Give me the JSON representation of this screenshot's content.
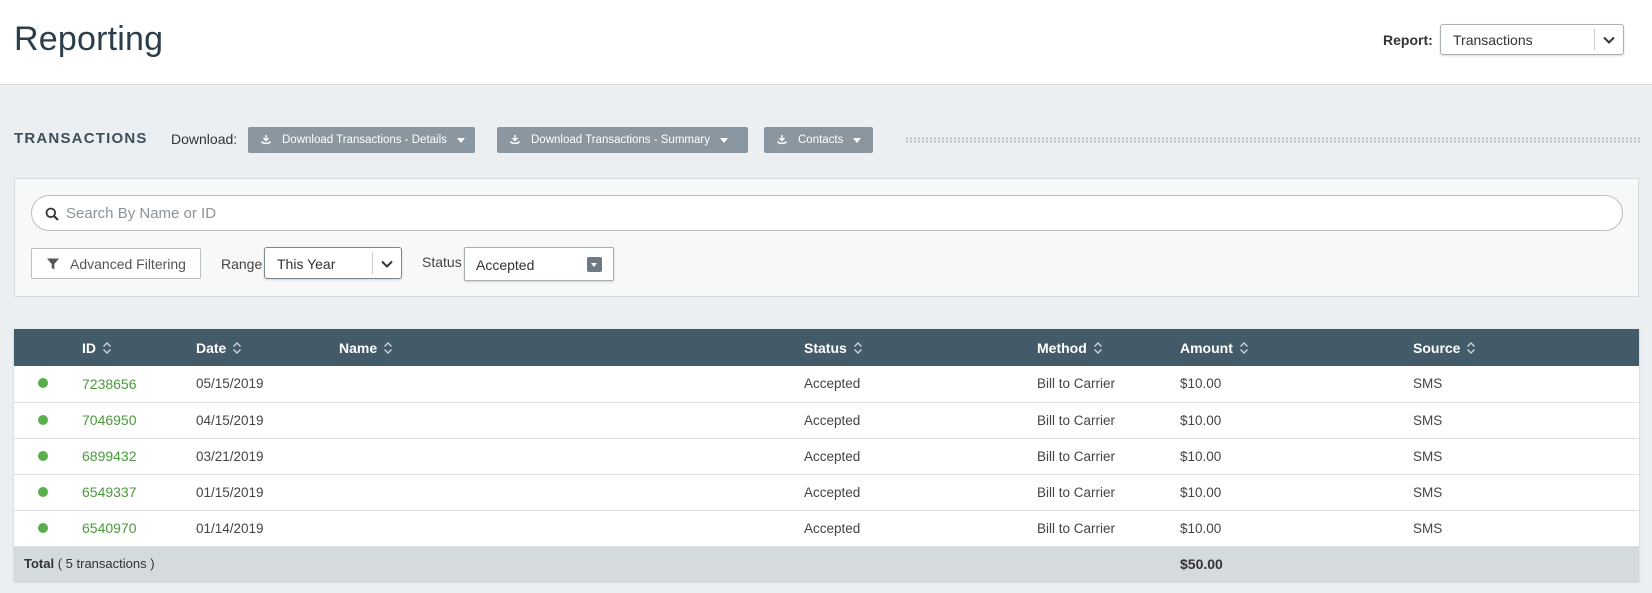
{
  "header": {
    "title": "Reporting",
    "report_label": "Report:",
    "report_value": "Transactions"
  },
  "toolbar": {
    "section_title": "TRANSACTIONS",
    "download_label": "Download:",
    "buttons": [
      {
        "label": "Download Transactions - Details"
      },
      {
        "label": "Download Transactions - Summary"
      },
      {
        "label": "Contacts"
      }
    ]
  },
  "filters": {
    "search_placeholder": "Search By Name or ID",
    "advanced_label": "Advanced Filtering",
    "range_label": "Range",
    "range_value": "This Year",
    "status_label": "Status",
    "status_value": "Accepted"
  },
  "table": {
    "columns": [
      "ID",
      "Date",
      "Name",
      "Status",
      "Method",
      "Amount",
      "Source"
    ],
    "rows": [
      {
        "id": "7238656",
        "date": "05/15/2019",
        "name": "",
        "status": "Accepted",
        "method": "Bill to Carrier",
        "amount": "$10.00",
        "source": "SMS"
      },
      {
        "id": "7046950",
        "date": "04/15/2019",
        "name": "",
        "status": "Accepted",
        "method": "Bill to Carrier",
        "amount": "$10.00",
        "source": "SMS"
      },
      {
        "id": "6899432",
        "date": "03/21/2019",
        "name": "",
        "status": "Accepted",
        "method": "Bill to Carrier",
        "amount": "$10.00",
        "source": "SMS"
      },
      {
        "id": "6549337",
        "date": "01/15/2019",
        "name": "",
        "status": "Accepted",
        "method": "Bill to Carrier",
        "amount": "$10.00",
        "source": "SMS"
      },
      {
        "id": "6540970",
        "date": "01/14/2019",
        "name": "",
        "status": "Accepted",
        "method": "Bill to Carrier",
        "amount": "$10.00",
        "source": "SMS"
      }
    ],
    "footer": {
      "total_label": "Total",
      "total_count": "( 5 transactions )",
      "total_amount": "$50.00"
    }
  },
  "colors": {
    "header_bg": "#435b69",
    "id_link": "#4a9a3c",
    "status_dot": "#5aae4b",
    "button_bg": "#8a97a0"
  },
  "icons": [
    "download-icon",
    "search-icon",
    "filter-icon",
    "chevron-down-icon",
    "sort-icon",
    "status-dot-icon"
  ]
}
